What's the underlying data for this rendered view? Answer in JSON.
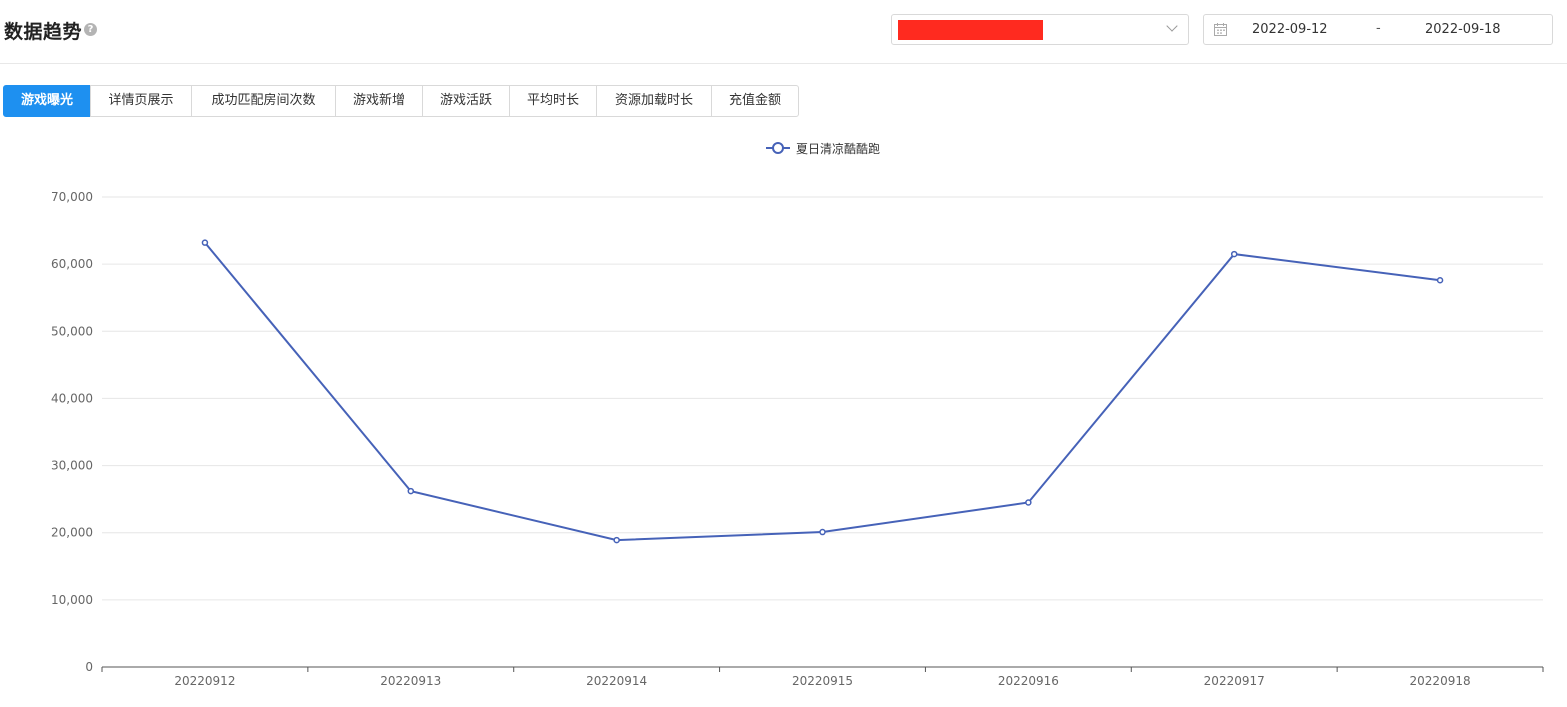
{
  "header": {
    "title": "数据趋势",
    "help_icon": "question-circle-icon",
    "select": {
      "selected_value": "",
      "redaction_color": "#ff2a1f"
    },
    "date_range": {
      "start": "2022-09-12",
      "separator": "-",
      "end": "2022-09-18",
      "icon": "calendar-icon"
    }
  },
  "tabs": [
    {
      "label": "游戏曝光",
      "active": true
    },
    {
      "label": "详情页展示",
      "active": false
    },
    {
      "label": "成功匹配房间次数",
      "active": false
    },
    {
      "label": "游戏新增",
      "active": false
    },
    {
      "label": "游戏活跃",
      "active": false
    },
    {
      "label": "平均时长",
      "active": false
    },
    {
      "label": "资源加载时长",
      "active": false
    },
    {
      "label": "充值金额",
      "active": false
    }
  ],
  "colors": {
    "accent": "#1e90f0",
    "series": "#4662b8"
  },
  "chart_data": {
    "type": "line",
    "categories": [
      "20220912",
      "20220913",
      "20220914",
      "20220915",
      "20220916",
      "20220917",
      "20220918"
    ],
    "series": [
      {
        "name": "夏日清凉酷酷跑",
        "values": [
          63200,
          26200,
          18900,
          20100,
          24500,
          61500,
          57600
        ]
      }
    ],
    "y_ticks": [
      "0",
      "10,000",
      "20,000",
      "30,000",
      "40,000",
      "50,000",
      "60,000",
      "70,000"
    ],
    "ylim": [
      0,
      70000
    ],
    "grid": true,
    "legend_position": "top-center"
  }
}
